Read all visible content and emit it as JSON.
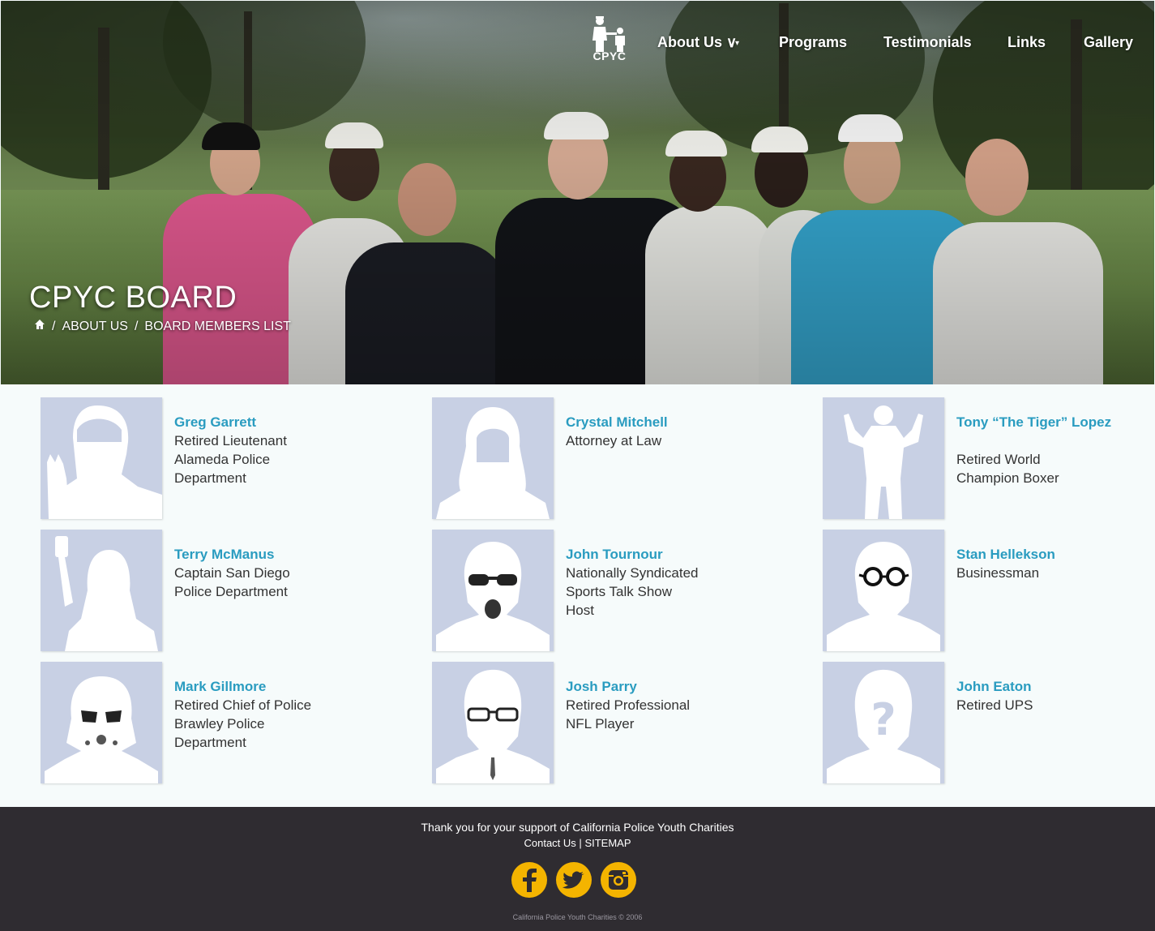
{
  "nav": {
    "logo_text": "CPYC",
    "items": [
      {
        "label": "About Us ∨"
      },
      {
        "label": "Programs"
      },
      {
        "label": "Testimonials"
      },
      {
        "label": "Links"
      },
      {
        "label": "Gallery"
      }
    ]
  },
  "hero": {
    "title": "CPYC BOARD",
    "breadcrumb": {
      "home_icon": "home-icon",
      "items": [
        "ABOUT US",
        "BOARD MEMBERS LIST"
      ],
      "separator": "/"
    }
  },
  "members": [
    {
      "name": "Greg Garrett",
      "role": [
        "Retired Lieutenant",
        "Alameda Police",
        "Department"
      ],
      "avatar_icon": "spock-silhouette-icon"
    },
    {
      "name": "Crystal Mitchell",
      "role": [
        "Attorney at Law"
      ],
      "avatar_icon": "woman-silhouette-icon"
    },
    {
      "name": "Tony “The Tiger” Lopez",
      "role": [
        "Retired World",
        "Champion Boxer"
      ],
      "avatar_icon": "boxer-silhouette-icon"
    },
    {
      "name": "Terry McManus",
      "role": [
        "Captain San Diego",
        "Police Department"
      ],
      "avatar_icon": "selfie-silhouette-icon"
    },
    {
      "name": "John Tournour",
      "role": [
        "Nationally Syndicated",
        "Sports Talk Show",
        "Host"
      ],
      "avatar_icon": "sunglasses-silhouette-icon"
    },
    {
      "name": "Stan Hellekson",
      "role": [
        "Businessman"
      ],
      "avatar_icon": "glasses-silhouette-icon"
    },
    {
      "name": "Mark Gillmore",
      "role": [
        "Retired Chief of Police",
        "Brawley Police",
        "Department"
      ],
      "avatar_icon": "stormtrooper-silhouette-icon"
    },
    {
      "name": "Josh Parry",
      "role": [
        "Retired Professional",
        "NFL Player"
      ],
      "avatar_icon": "hipster-silhouette-icon"
    },
    {
      "name": "John Eaton",
      "role": [
        "Retired UPS"
      ],
      "avatar_icon": "question-silhouette-icon"
    }
  ],
  "footer": {
    "thanks": "Thank you for your support of California Police Youth Charities",
    "contact_label": "Contact Us",
    "divider": "|",
    "sitemap_label": "SITEMAP",
    "social": [
      {
        "name": "facebook-icon",
        "glyph": "f"
      },
      {
        "name": "twitter-icon",
        "glyph": "🐦"
      },
      {
        "name": "instagram-icon",
        "glyph": "▣"
      }
    ],
    "copyright": "California Police Youth Charities © 2006"
  },
  "colors": {
    "name_link": "#2a9cc0",
    "footer_bg": "#2f2c31",
    "social_bg": "#f4b400",
    "avatar_bg": "#c8d0e4"
  }
}
